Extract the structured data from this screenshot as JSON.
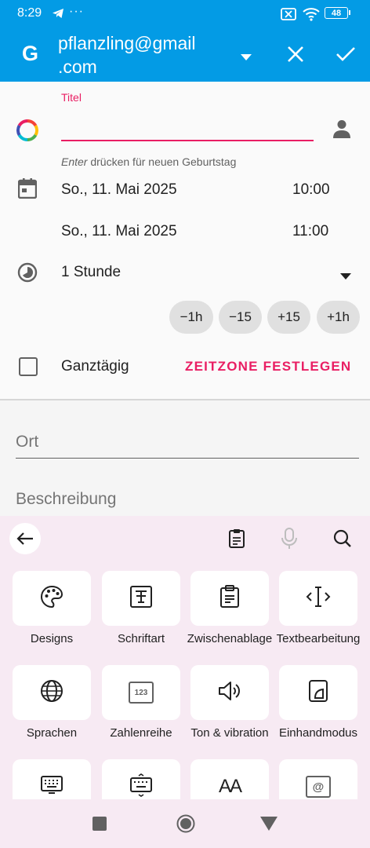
{
  "status_bar": {
    "time": "8:29",
    "battery": "48",
    "dots": "···"
  },
  "app_bar": {
    "account_logo": "G",
    "account_line1": "pflanzling@gmail",
    "account_line2": ".com",
    "icons": [
      "dropdown-arrow-icon",
      "close-icon",
      "check-icon"
    ]
  },
  "form": {
    "title_label": "Titel",
    "title_value": "",
    "hint_italic": "Enter",
    "hint_rest": " drücken für neuen Geburtstag",
    "start_date": "So., 11. Mai 2025",
    "start_time": "10:00",
    "end_date": "So., 11. Mai 2025",
    "end_time": "11:00",
    "duration": "1 Stunde",
    "chips": [
      "−1h",
      "−15",
      "+15",
      "+1h"
    ],
    "all_day_label": "Ganztägig",
    "all_day_checked": false,
    "timezone_button": "ZEITZONE FESTLEGEN",
    "accent_color": "#e91e63"
  },
  "location_placeholder": "Ort",
  "description_placeholder": "Beschreibung",
  "keyboard": {
    "toolbar_icons": [
      "back-arrow-icon",
      "clipboard-icon",
      "microphone-icon",
      "search-icon"
    ],
    "tiles": [
      {
        "label": "Designs",
        "icon": "palette-icon"
      },
      {
        "label": "Schriftart",
        "icon": "font-icon"
      },
      {
        "label": "Zwischenablage",
        "icon": "clipboard-icon"
      },
      {
        "label": "Textbearbeitung",
        "icon": "text-cursor-icon"
      },
      {
        "label": "Sprachen",
        "icon": "globe-icon"
      },
      {
        "label": "Zahlenreihe",
        "icon": "number-row-icon",
        "icon_text": "123"
      },
      {
        "label": "Ton & vibration",
        "icon": "speaker-icon"
      },
      {
        "label": "Einhandmodus",
        "icon": "one-hand-icon"
      },
      {
        "label": "",
        "icon": "keyboard-icon"
      },
      {
        "label": "",
        "icon": "keyboard-resize-icon"
      },
      {
        "label": "",
        "icon": "text-size-icon",
        "icon_text": "AA"
      },
      {
        "label": "",
        "icon": "at-sign-icon",
        "icon_text": "@"
      }
    ]
  },
  "nav_bar": {
    "icons": [
      "recent-apps-icon",
      "home-icon",
      "back-icon"
    ]
  }
}
